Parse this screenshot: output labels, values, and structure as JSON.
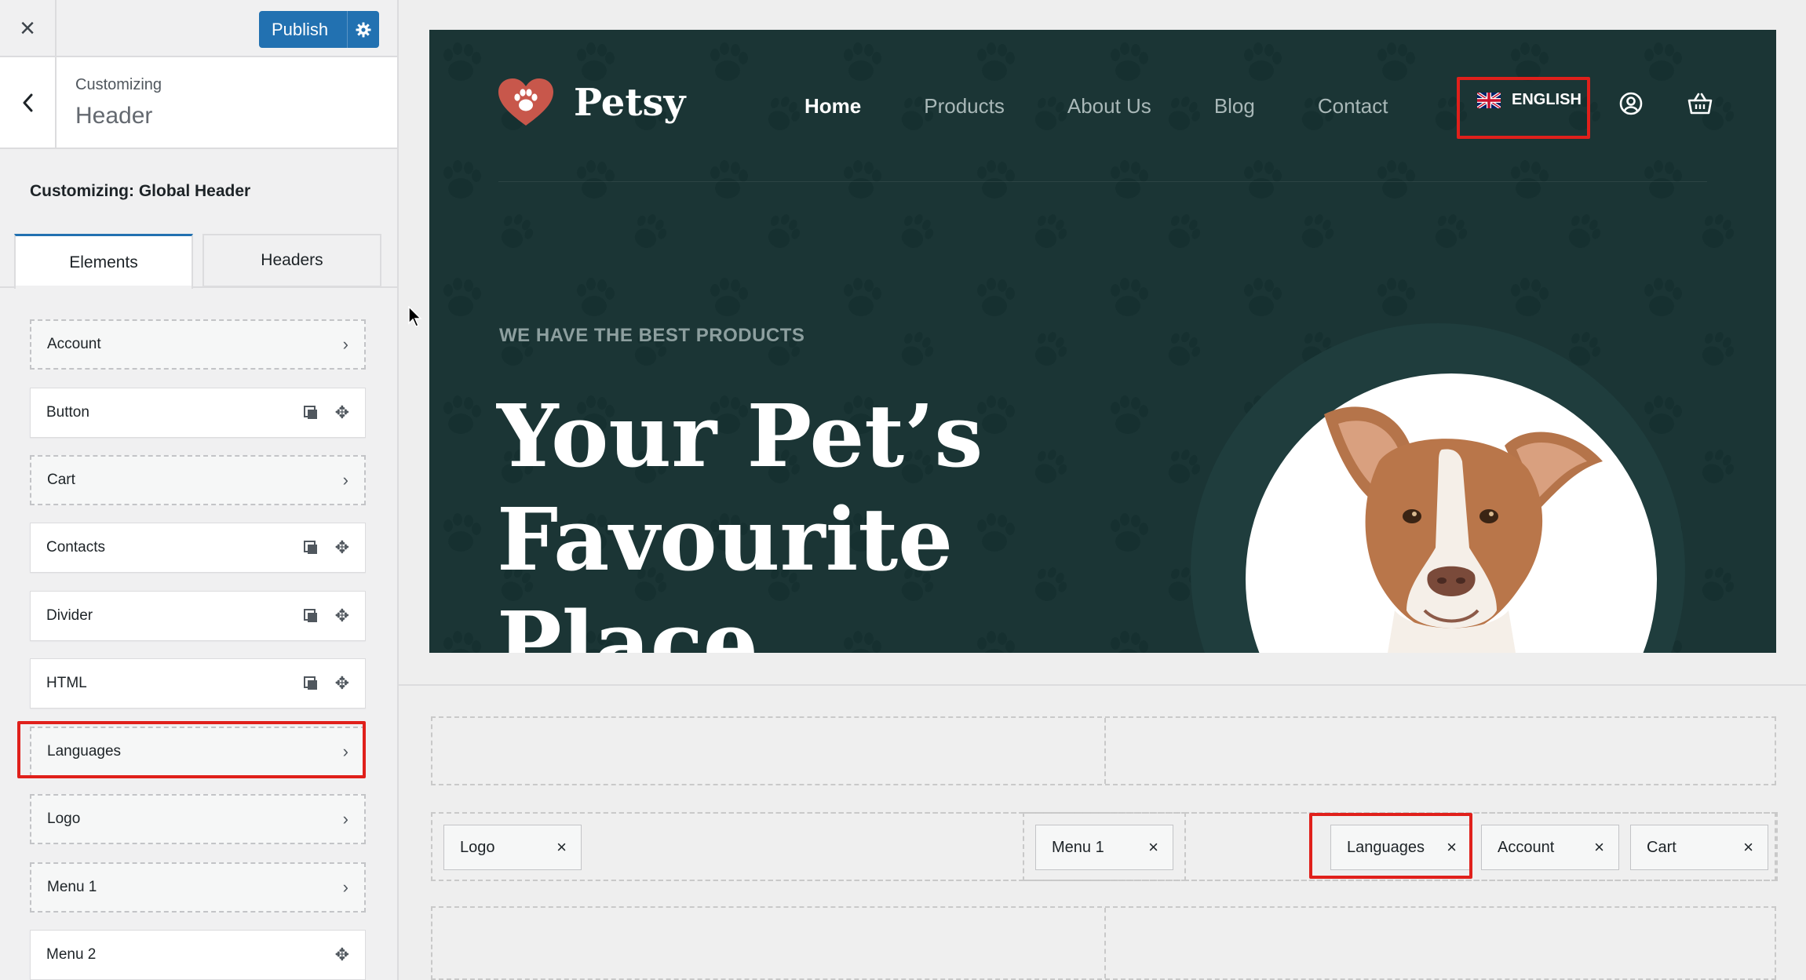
{
  "topbar": {
    "close_icon": "×",
    "publish_label": "Publish",
    "publish_settings_icon": "gear-icon"
  },
  "panel": {
    "back_icon": "‹",
    "crumb_small": "Customizing",
    "crumb_big": "Header",
    "section_heading": "Customizing: Global Header"
  },
  "tabs": {
    "elements": "Elements",
    "headers": "Headers"
  },
  "elements": [
    {
      "label": "Account",
      "style": "dashed",
      "action": "chevron"
    },
    {
      "label": "Button",
      "style": "solid",
      "action": "duplicate-move"
    },
    {
      "label": "Cart",
      "style": "dashed",
      "action": "chevron"
    },
    {
      "label": "Contacts",
      "style": "solid",
      "action": "duplicate-move"
    },
    {
      "label": "Divider",
      "style": "solid",
      "action": "duplicate-move"
    },
    {
      "label": "HTML",
      "style": "solid",
      "action": "duplicate-move"
    },
    {
      "label": "Languages",
      "style": "dashed",
      "action": "chevron",
      "highlighted": true
    },
    {
      "label": "Logo",
      "style": "dashed",
      "action": "chevron"
    },
    {
      "label": "Menu 1",
      "style": "dashed",
      "action": "chevron"
    },
    {
      "label": "Menu 2",
      "style": "solid",
      "action": "move"
    }
  ],
  "preview": {
    "site_name": "Petsy",
    "nav": [
      "Home",
      "Products",
      "About Us",
      "Blog",
      "Contact"
    ],
    "nav_active": "Home",
    "language": "ENGLISH",
    "hero_tag": "WE HAVE THE BEST PRODUCTS",
    "hero_title": "Your Pet’s Favourite Place",
    "colors": {
      "background": "#1b3535",
      "logo_heart": "#c8574b",
      "highlight": "#e0201b",
      "publish": "#2271b1"
    }
  },
  "builder": {
    "chips": [
      {
        "label": "Logo",
        "close": "×"
      },
      {
        "label": "Menu 1",
        "close": "×"
      },
      {
        "label": "Languages",
        "close": "×",
        "highlighted": true
      },
      {
        "label": "Account",
        "close": "×"
      },
      {
        "label": "Cart",
        "close": "×"
      }
    ]
  }
}
